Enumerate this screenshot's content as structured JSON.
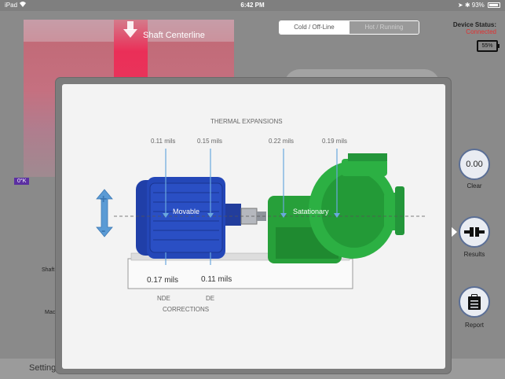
{
  "status_bar": {
    "carrier": "iPad",
    "time": "6:42 PM",
    "battery": "93%"
  },
  "heatmap": {
    "title": "Shaft Centerline",
    "zero_label": "0°K"
  },
  "mode_toggle": {
    "options": [
      "Cold / Off-Line",
      "Hot / Running"
    ],
    "selected": "Cold / Off-Line"
  },
  "device": {
    "label": "Device Status:",
    "status": "Connected",
    "battery": "55%"
  },
  "side_buttons": [
    {
      "value": "0.00",
      "label": "Clear"
    },
    {
      "label": "Results"
    },
    {
      "label": "Report"
    }
  ],
  "left_labels": [
    "Shaft",
    "Mac"
  ],
  "bottom": {
    "settings": "Setting"
  },
  "dialog": {
    "title": "THERMAL EXPANSIONS",
    "motor_label": "Movable",
    "pump_label": "Satationary",
    "expansion_values": [
      "0.11 mils",
      "0.15 mils",
      "0.22 mils",
      "0.19 mils"
    ],
    "correction_values": [
      "0.17 mils",
      "0.11 mils"
    ],
    "correction_feet": [
      "NDE",
      "DE"
    ],
    "corrections_title": "CORRECTIONS",
    "plus": "+",
    "minus": "-",
    "colors": {
      "motor": "#1f3fae",
      "pump": "#28a23c",
      "arrow": "#5b9bd5"
    }
  }
}
